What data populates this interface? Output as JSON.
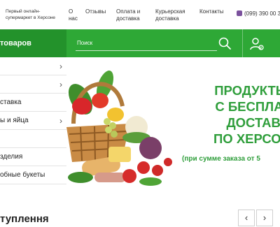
{
  "header": {
    "tagline": "Первый онлайн-супермаркет в Херсоне",
    "nav": [
      "О нас",
      "Отзывы",
      "Оплата и доставка",
      "Курьерская доставка",
      "Контакты"
    ],
    "phone": "(099) 390 00 3"
  },
  "bar": {
    "catalog_label": "товаров",
    "search_placeholder": "Поиск"
  },
  "sidebar": {
    "items": [
      {
        "label": "",
        "has_arrow": true
      },
      {
        "label": "",
        "has_arrow": true
      },
      {
        "label": "ставка",
        "has_arrow": false
      },
      {
        "label": "ы и яйца",
        "has_arrow": true
      },
      {
        "label": "",
        "has_arrow": false
      },
      {
        "label": "зделия",
        "has_arrow": false
      },
      {
        "label": "обные букеты",
        "has_arrow": false
      }
    ]
  },
  "banner": {
    "lines": [
      "ПРОДУКТЫ НА",
      "С БЕСПЛАТНО",
      "ДОСТАВКО",
      "ПО ХЕРСОНУ И"
    ],
    "note": "(при сумме заказа от 5",
    "accent_color": "#2f9e3b"
  },
  "section": {
    "title": "туплення",
    "prev_icon": "‹",
    "next_icon": "›"
  },
  "colors": {
    "brand_green": "#2ea836",
    "brand_green_dark": "#23922b",
    "viber_purple": "#7b519d"
  }
}
